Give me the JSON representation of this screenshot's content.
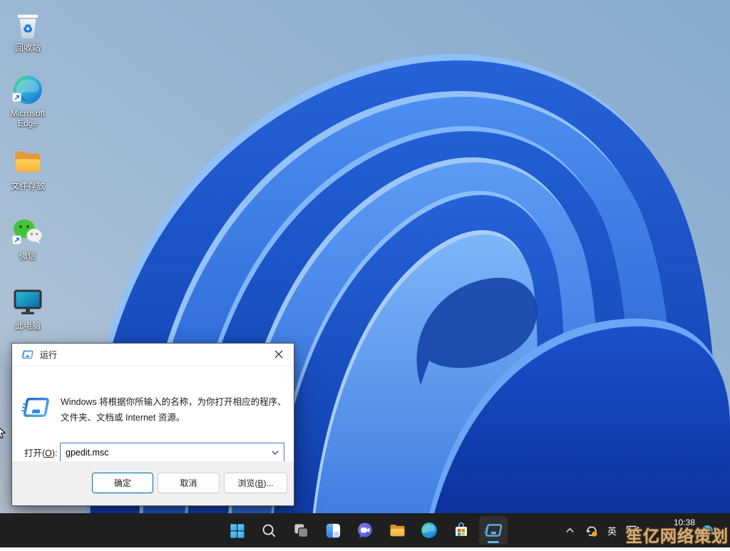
{
  "desktop": {
    "icons": [
      {
        "id": "recycle-bin",
        "label": "回收站"
      },
      {
        "id": "edge",
        "label": "Microsoft Edge"
      },
      {
        "id": "folder",
        "label": "文件存放"
      },
      {
        "id": "wechat",
        "label": "微信"
      },
      {
        "id": "this-pc",
        "label": "此电脑"
      }
    ]
  },
  "run_dialog": {
    "title": "运行",
    "description_line1": "Windows 将根据你所输入的名称，为你打开相应的程序、",
    "description_line2": "文件夹、文档或 Internet 资源。",
    "open_label": {
      "prefix": "打开(",
      "key": "O",
      "suffix": "):"
    },
    "input_value": "gpedit.msc",
    "buttons": {
      "ok": "确定",
      "cancel": "取消",
      "browse": {
        "prefix": "浏览(",
        "key": "B",
        "suffix": ")..."
      }
    }
  },
  "taskbar": {
    "icons": [
      "start",
      "search",
      "task-view",
      "widgets",
      "chat",
      "file-explorer",
      "edge",
      "store",
      "run-active"
    ],
    "tray": {
      "ime": "英",
      "time": "10:38"
    },
    "watermark": "笙亿网络策划"
  },
  "colors": {
    "accent": "#0067c0",
    "taskbar_bg": "#1f1f1f",
    "watermark": "#d7ad7f",
    "ok_border": "#0067c0"
  }
}
